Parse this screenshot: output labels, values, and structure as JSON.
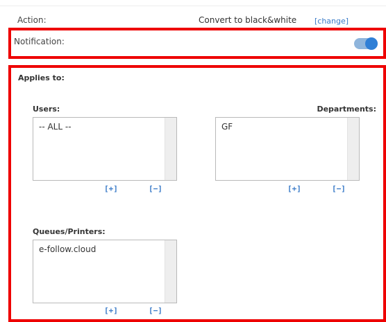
{
  "rule": {
    "action_label": "Action:",
    "action_value": "Convert to black&white",
    "change_link": "[change]",
    "notification_label": "Notification:",
    "notification_enabled": true
  },
  "applies": {
    "title": "Applies to:",
    "users": {
      "label": "Users:",
      "items": [
        "-- ALL --"
      ],
      "add_label": "[+]",
      "remove_label": "[−]"
    },
    "departments": {
      "label": "Departments:",
      "items": [
        "GF"
      ],
      "add_label": "[+]",
      "remove_label": "[−]"
    },
    "queues": {
      "label": "Queues/Printers:",
      "items": [
        "e-follow.cloud"
      ],
      "add_label": "[+]",
      "remove_label": "[−]"
    }
  },
  "colors": {
    "highlight": "#ee0000",
    "link": "#3a7bc8",
    "toggle_on": "#2f7fd6"
  }
}
